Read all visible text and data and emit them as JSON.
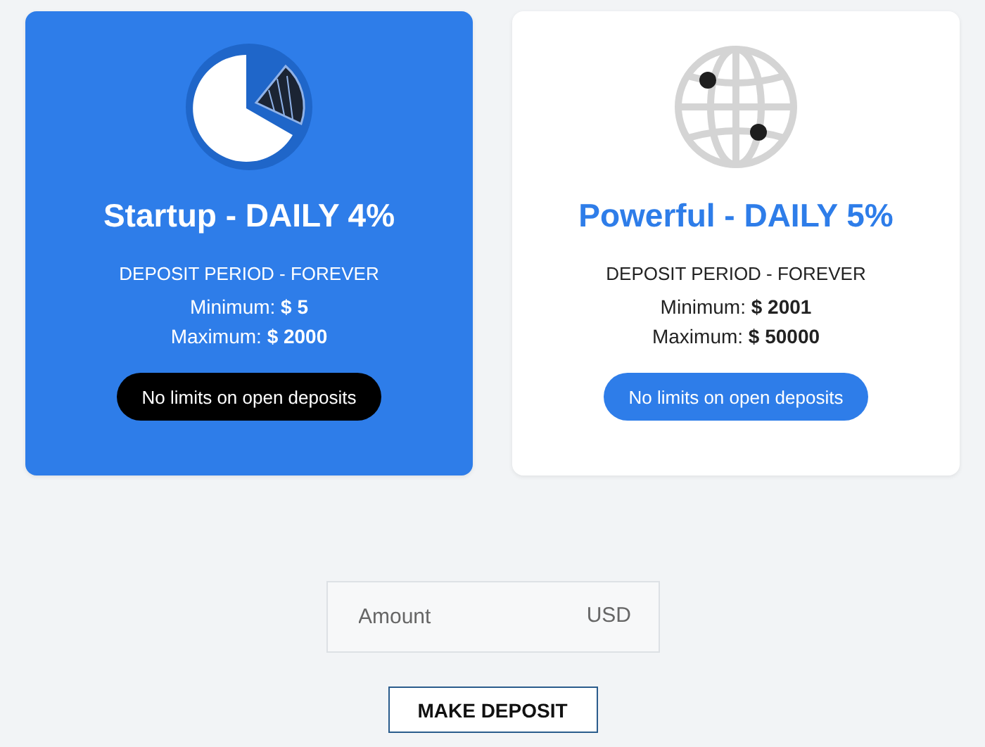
{
  "plans": [
    {
      "kind": "pie",
      "selected": true,
      "title": "Startup - DAILY 4%",
      "period": "DEPOSIT PERIOD - FOREVER",
      "minimum": "Minimum: **$ 5**",
      "maximum": "Maximum: **$ 2000**",
      "button": "No limits on open deposits"
    },
    {
      "kind": "globe",
      "selected": false,
      "title": "Powerful - DAILY 5%",
      "period": "DEPOSIT PERIOD - FOREVER",
      "minimum": "Minimum: **$ 2001**",
      "maximum": "Maximum: **$ 50000**",
      "button": "No limits on open deposits"
    }
  ],
  "amount": {
    "placeholder": "Amount",
    "currency": "USD"
  },
  "submit": "MAKE DEPOSIT"
}
